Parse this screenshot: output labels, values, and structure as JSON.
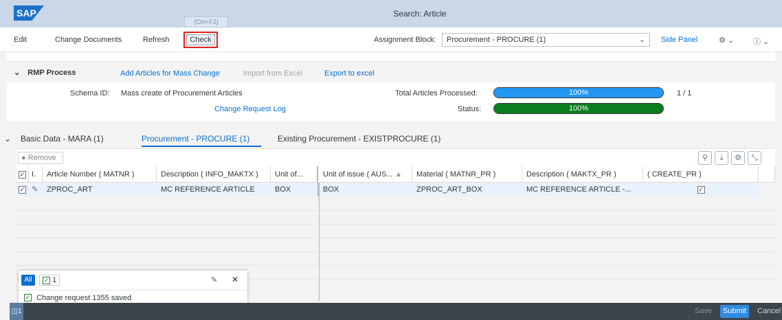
{
  "shell": {
    "logo": "SAP",
    "tooltip": "(Ctrl+F2)",
    "title": "Search: Article"
  },
  "toolbar": {
    "edit": "Edit",
    "change_documents": "Change Documents",
    "refresh": "Refresh",
    "check": "Check",
    "assignment_label": "Assignment Block:",
    "assignment_value": "Procurement - PROCURE (1)",
    "side_panel": "Side Panel"
  },
  "rmp": {
    "title": "RMP Process",
    "add_articles": "Add Articles for Mass Change",
    "import_excel": "Import from Excel",
    "export_excel": "Export to excel",
    "schema_label": "Schema ID:",
    "schema_value": "Mass create of Procurement Articles",
    "change_request_log": "Change Request Log",
    "total_label": "Total Articles Processed:",
    "total_progress": 1.0,
    "total_percent": "100%",
    "total_count": "1 / 1",
    "status_label": "Status:",
    "status_progress": 1.0,
    "status_percent": "100%",
    "colors": {
      "total_bar": "#2196f3",
      "status_bar": "#0a7d1e"
    }
  },
  "tabs": [
    {
      "label": "Basic Data - MARA (1)"
    },
    {
      "label": "Procurement - PROCURE (1)"
    },
    {
      "label": "Existing Procurement - EXISTPROCURE (1)"
    }
  ],
  "table_toolbar": {
    "remove": "Remove"
  },
  "table": {
    "headers": [
      "I.",
      "Article Number ( MATNR )",
      "Description ( INFO_MAKTX )",
      "Unit of...",
      "Unit of issue ( AUS...",
      "Material ( MATNR_PR )",
      "Description ( MAKTX_PR )",
      "( CREATE_PR )"
    ],
    "rows": [
      [
        "ZPROC_ART",
        "MC REFERENCE ARTICLE",
        "BOX",
        "BOX",
        "ZPROC_ART_BOX",
        "MC REFERENCE  ARTICLE -..."
      ]
    ]
  },
  "messages": {
    "all": "All",
    "count": "1",
    "text": "Change request 1355 saved"
  },
  "footer": {
    "indicator_count": "1",
    "save": "Save",
    "submit": "Submit",
    "cancel": "Cancel"
  }
}
